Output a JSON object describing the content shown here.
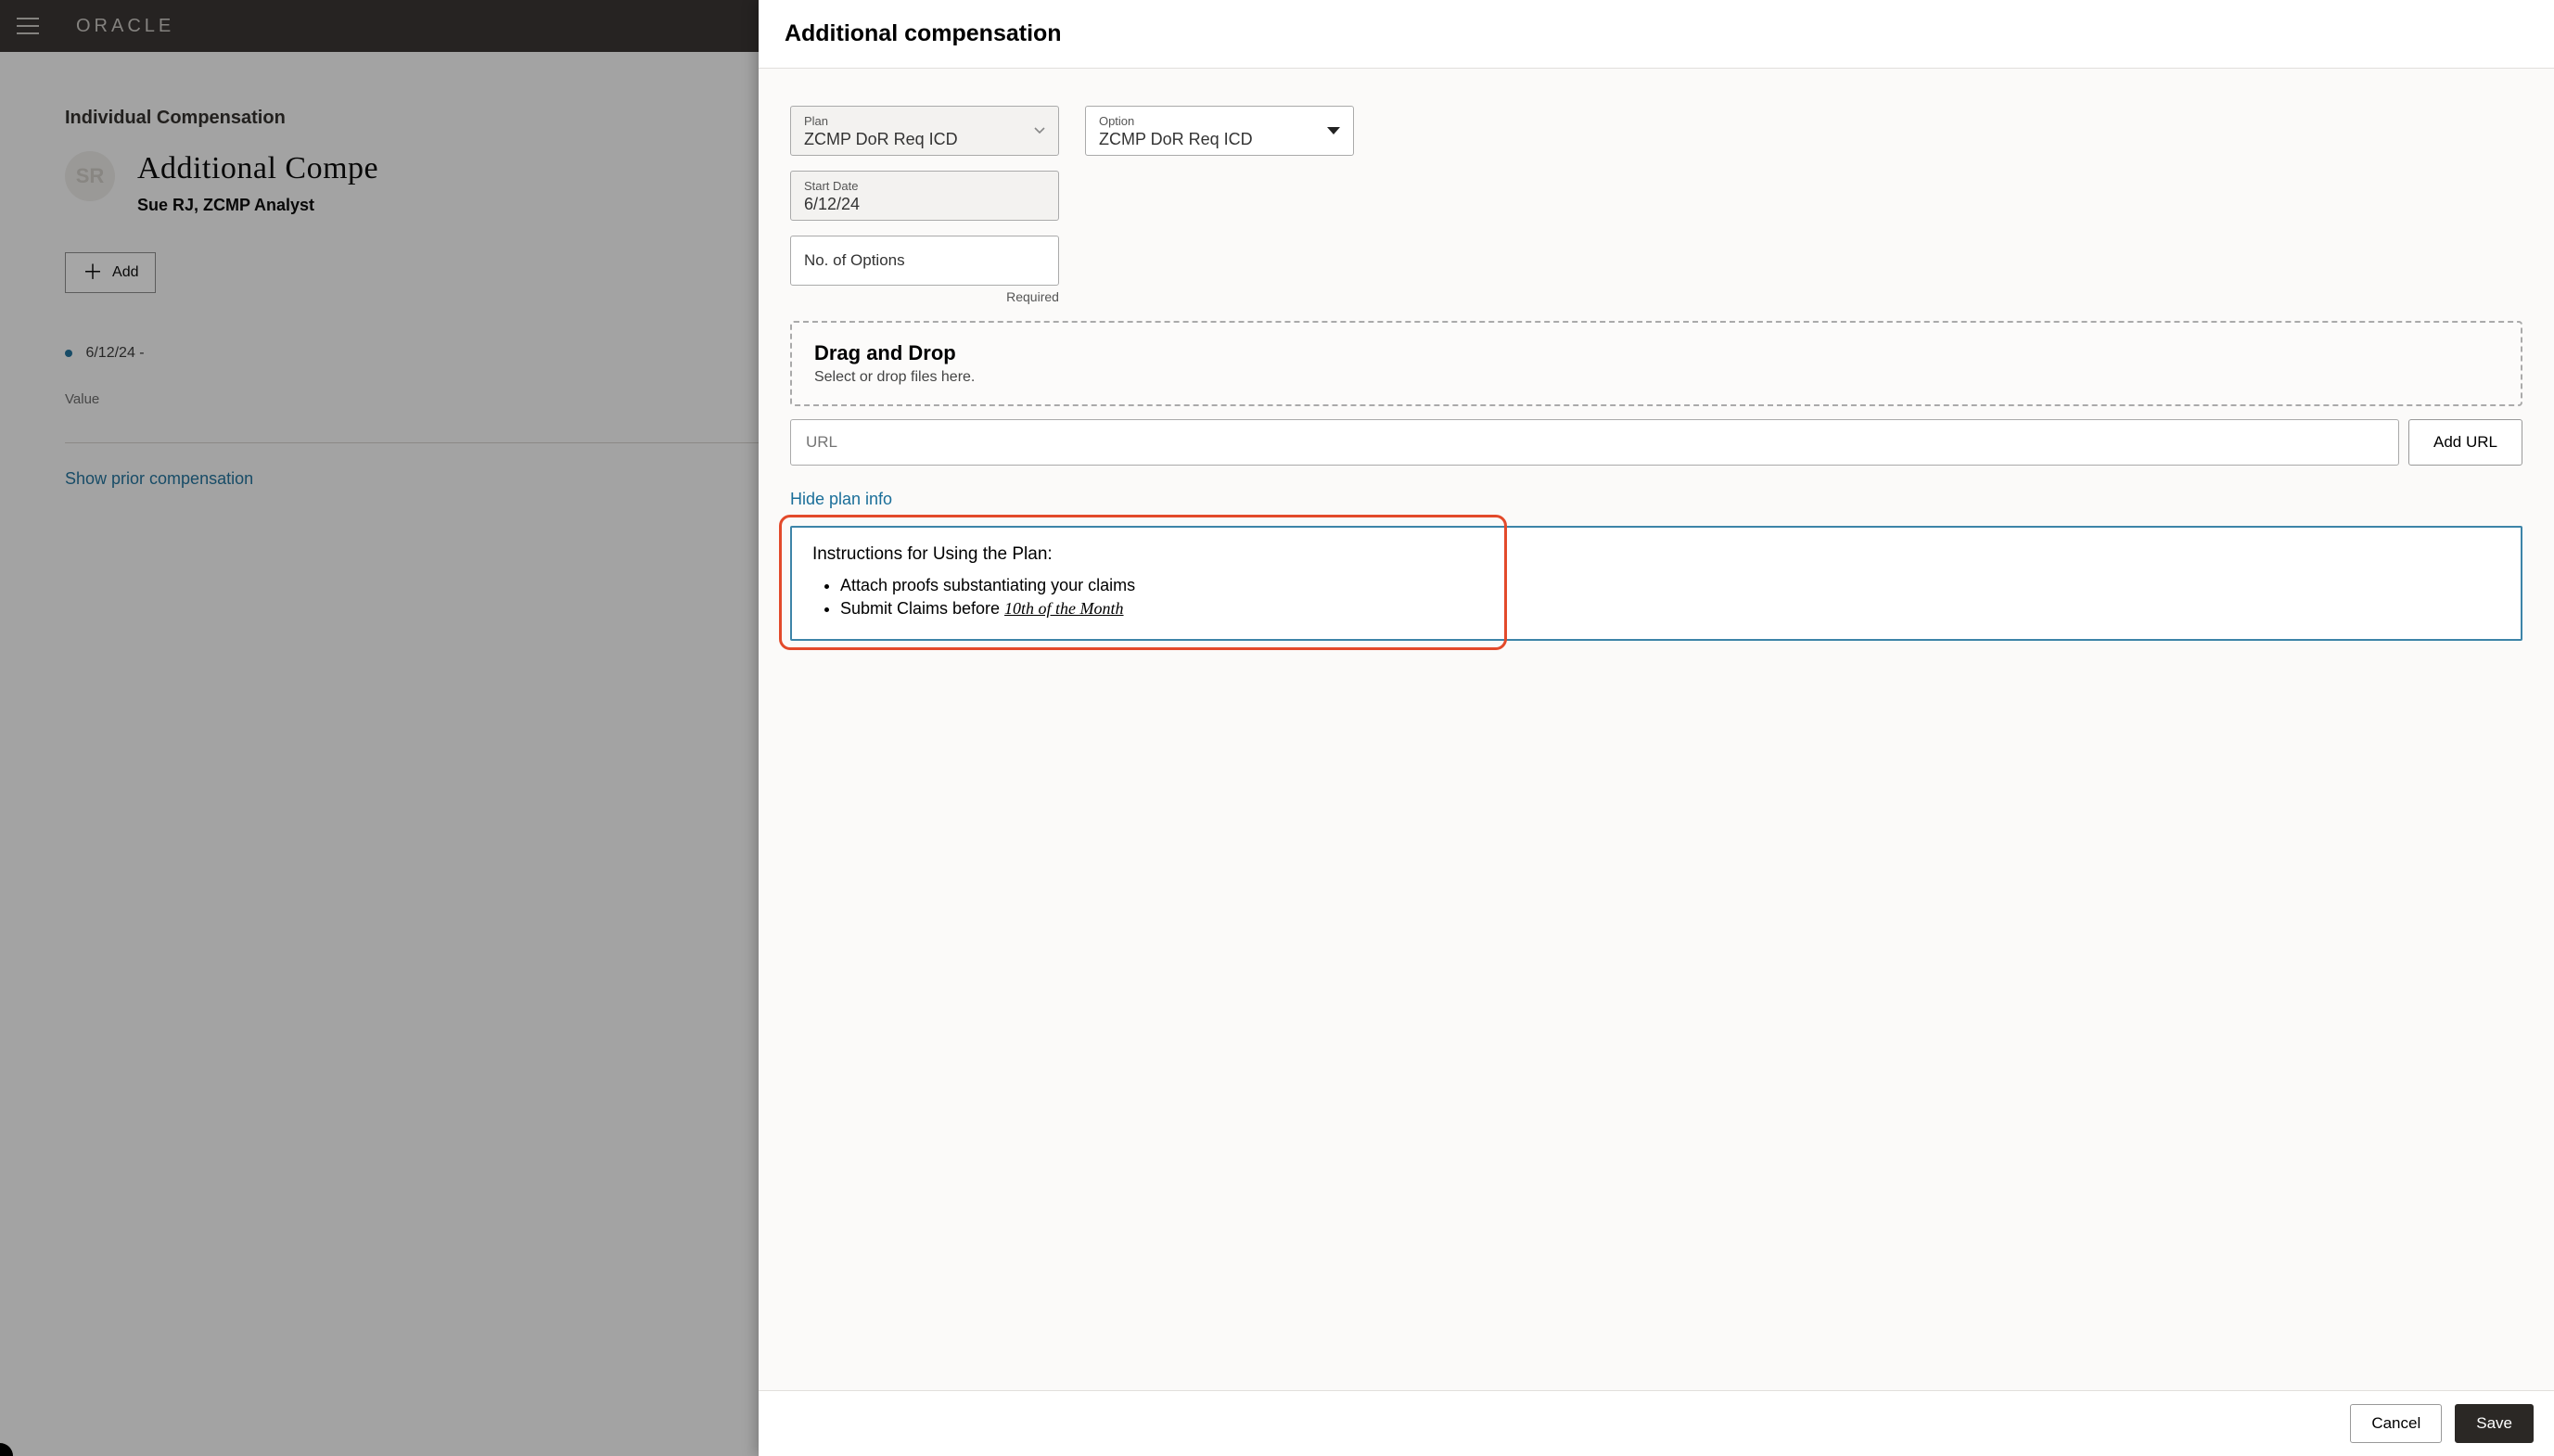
{
  "brand": "ORACLE",
  "page": {
    "section_title": "Individual Compensation",
    "avatar_initials": "SR",
    "heading": "Additional Compe",
    "employee": "Sue RJ, ZCMP Analyst",
    "add_label": "Add",
    "entry_date": "6/12/24 -",
    "value_label": "Value",
    "show_prior": "Show prior compensation"
  },
  "drawer": {
    "title": "Additional compensation",
    "plan_label": "Plan",
    "plan_value": "ZCMP DoR Req ICD",
    "option_label": "Option",
    "option_value": "ZCMP DoR Req ICD",
    "start_date_label": "Start Date",
    "start_date_value": "6/12/24",
    "numopts_label": "No. of Options",
    "required": "Required",
    "dz_title": "Drag and Drop",
    "dz_sub": "Select or drop files here.",
    "url_placeholder": "URL",
    "add_url": "Add URL",
    "hide_link": "Hide plan info",
    "info_title": "Instructions for Using the Plan:",
    "info_bullets": [
      {
        "prefix": "Attach proofs substantiating your claims",
        "em": ""
      },
      {
        "prefix": "Submit Claims before ",
        "em": "10th of the Month"
      }
    ],
    "cancel": "Cancel",
    "save": "Save"
  }
}
